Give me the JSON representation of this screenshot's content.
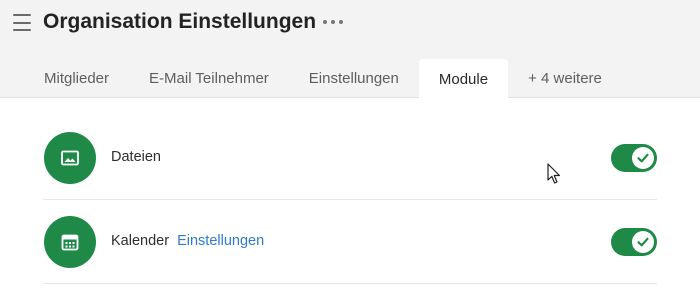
{
  "header": {
    "title": "Organisation Einstellungen",
    "menu_icon": "hamburger-menu-icon",
    "more_icon": "more-horizontal-icon"
  },
  "tabs": [
    {
      "label": "Mitglieder",
      "active": false
    },
    {
      "label": "E-Mail Teilnehmer",
      "active": false
    },
    {
      "label": "Einstellungen",
      "active": false
    },
    {
      "label": "Module",
      "active": true
    },
    {
      "label": "+ 4 weitere",
      "active": false
    }
  ],
  "modules": [
    {
      "label": "Dateien",
      "icon": "image-icon",
      "link": "",
      "enabled": true
    },
    {
      "label": "Kalender",
      "icon": "calendar-icon",
      "link": "Einstellungen",
      "enabled": true
    }
  ],
  "colors": {
    "accent": "#1f8a48",
    "link": "#2f7bc8",
    "header_bg": "#f3f3f3"
  }
}
